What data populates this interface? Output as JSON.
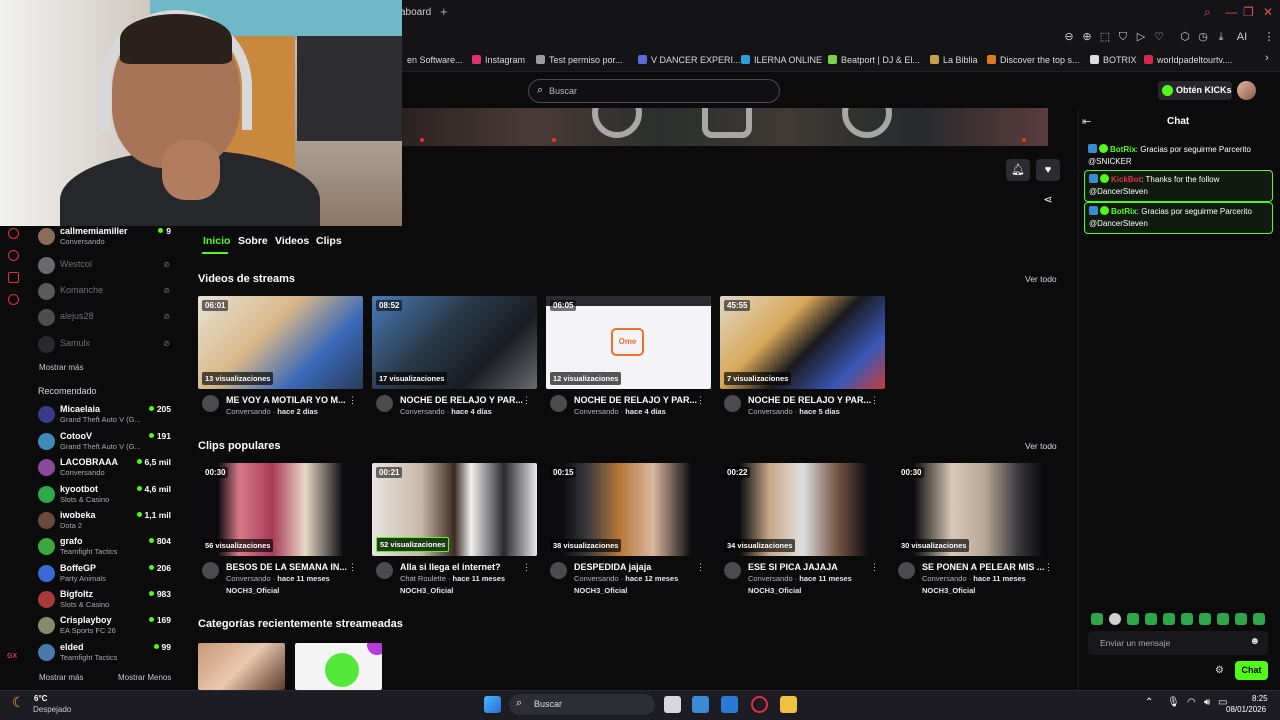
{
  "browser": {
    "tab_label": "aboard",
    "new_tab": "+",
    "bookmarks": [
      {
        "label": "en Software...",
        "color": "#2f6fd8"
      },
      {
        "label": "Instagram",
        "color": "#e1306c"
      },
      {
        "label": "Test permiso por...",
        "color": "#9a9aa0"
      },
      {
        "label": "V DANCER EXPERI...",
        "color": "#5b6bd8"
      },
      {
        "label": "ILERNA ONLINE",
        "color": "#2aa0d8"
      },
      {
        "label": "Beatport | DJ & El...",
        "color": "#7dd04a"
      },
      {
        "label": "La Biblia",
        "color": "#c9a04a"
      },
      {
        "label": "Discover the top s...",
        "color": "#e07a1a"
      },
      {
        "label": "BOTRIX",
        "color": "#dddddd"
      },
      {
        "label": "worldpadeltourtv....",
        "color": "#d8264a"
      }
    ],
    "more": "›",
    "toolbar_ai": "AI"
  },
  "header": {
    "search_placeholder": "Buscar",
    "kicks_label": "Obtén KICKs"
  },
  "channel": {
    "tabs": [
      {
        "label": "Inicio"
      },
      {
        "label": "Sobre"
      },
      {
        "label": "Videos"
      },
      {
        "label": "Clips"
      }
    ]
  },
  "sidebar": {
    "following": [
      {
        "name": "callmemiamiller",
        "status": "Conversando",
        "count": "9",
        "live": true
      },
      {
        "name": "Westcol",
        "live": false
      },
      {
        "name": "Komanche",
        "live": false
      },
      {
        "name": "alejus28",
        "live": false
      },
      {
        "name": "Samulx",
        "live": false
      }
    ],
    "show_more": "Mostrar más",
    "recommended_heading": "Recomendado",
    "recommended": [
      {
        "name": "Micaelaia",
        "game": "Grand Theft Auto V (G...",
        "count": "205"
      },
      {
        "name": "CotooV",
        "game": "Grand Theft Auto V (G...",
        "count": "191"
      },
      {
        "name": "LACOBRAAA",
        "game": "Conversando",
        "count": "6,5 mil"
      },
      {
        "name": "kyootbot",
        "game": "Slots & Casino",
        "count": "4,6 mil"
      },
      {
        "name": "iwobeka",
        "game": "Dota 2",
        "count": "1,1 mil"
      },
      {
        "name": "grafo",
        "game": "Teamfight Tactics",
        "count": "804"
      },
      {
        "name": "BoffeGP",
        "game": "Party Animals",
        "count": "206"
      },
      {
        "name": "Bigfoltz",
        "game": "Slots & Casino",
        "count": "983"
      },
      {
        "name": "Crisplayboy",
        "game": "EA Sports FC 26",
        "count": "169"
      },
      {
        "name": "elded",
        "game": "Teamfight Tactics",
        "count": "99"
      }
    ],
    "show_more_bottom": "Mostrar más",
    "show_less": "Mostrar Menos"
  },
  "sections": {
    "streams_title": "Videos de streams",
    "clips_title": "Clips populares",
    "categories_title": "Categorías recientemente streameadas",
    "see_all": "Ver todo"
  },
  "streams": [
    {
      "duration": "06:01",
      "views": "13 visualizaciones",
      "title": "ME VOY A MOTILAR YO M...",
      "category": "Conversando",
      "age": "hace 2 días"
    },
    {
      "duration": "08:52",
      "views": "17 visualizaciones",
      "title": "NOCHE DE RELAJO Y PAR...",
      "category": "Conversando",
      "age": "hace 4 días"
    },
    {
      "duration": "06:05",
      "views": "12 visualizaciones",
      "title": "NOCHE DE RELAJO Y PAR...",
      "category": "Conversando",
      "age": "hace 4 días"
    },
    {
      "duration": "45:55",
      "views": "7 visualizaciones",
      "title": "NOCHE DE RELAJO Y PAR...",
      "category": "Conversando",
      "age": "hace 5 días"
    }
  ],
  "clips": [
    {
      "duration": "00:30",
      "views": "56 visualizaciones",
      "title": "BESOS DE LA SEMANA IN...",
      "category": "Conversando",
      "age": "hace 11 meses",
      "owner": "NOCH3_Oficial"
    },
    {
      "duration": "00:21",
      "views": "52 visualizaciones",
      "title": "Alla si llega el internet?",
      "category": "Chat Roulette",
      "age": "hace 11 meses",
      "owner": "NOCH3_Oficial"
    },
    {
      "duration": "00:15",
      "views": "38 visualizaciones",
      "title": "DESPEDIDA jajaja",
      "category": "Conversando",
      "age": "hace 12 meses",
      "owner": "NOCH3_Oficial"
    },
    {
      "duration": "00:22",
      "views": "34 visualizaciones",
      "title": "ESE SI PICA JAJAJA",
      "category": "Conversando",
      "age": "hace 11 meses",
      "owner": "NOCH3_Oficial"
    },
    {
      "duration": "00:30",
      "views": "30 visualizaciones",
      "title": "SE PONEN A PELEAR MIS ...",
      "category": "Conversando",
      "age": "hace 11 meses",
      "owner": "NOCH3_Oficial"
    }
  ],
  "chat": {
    "title": "Chat",
    "messages": [
      {
        "user": "BotRix",
        "user_color": "#53fc18",
        "text": ": Gracias por seguirme Parcerito @SNICKER",
        "highlight": false
      },
      {
        "user": "KickBot",
        "user_color": "#e0304a",
        "text": ": Thanks for the follow @DancerSteven",
        "highlight": true
      },
      {
        "user": "BotRix",
        "user_color": "#53fc18",
        "text": ": Gracias por seguirme Parcerito @DancerSteven",
        "highlight": true
      }
    ],
    "input_placeholder": "Enviar un mensaje",
    "send_label": "Chat"
  },
  "taskbar": {
    "weather_temp": "6°C",
    "weather_desc": "Despejado",
    "search_label": "Buscar",
    "time": "8:25",
    "date": "08/01/2026"
  },
  "colors": {
    "accent": "#53fc18",
    "background": "#0b0b0c"
  }
}
